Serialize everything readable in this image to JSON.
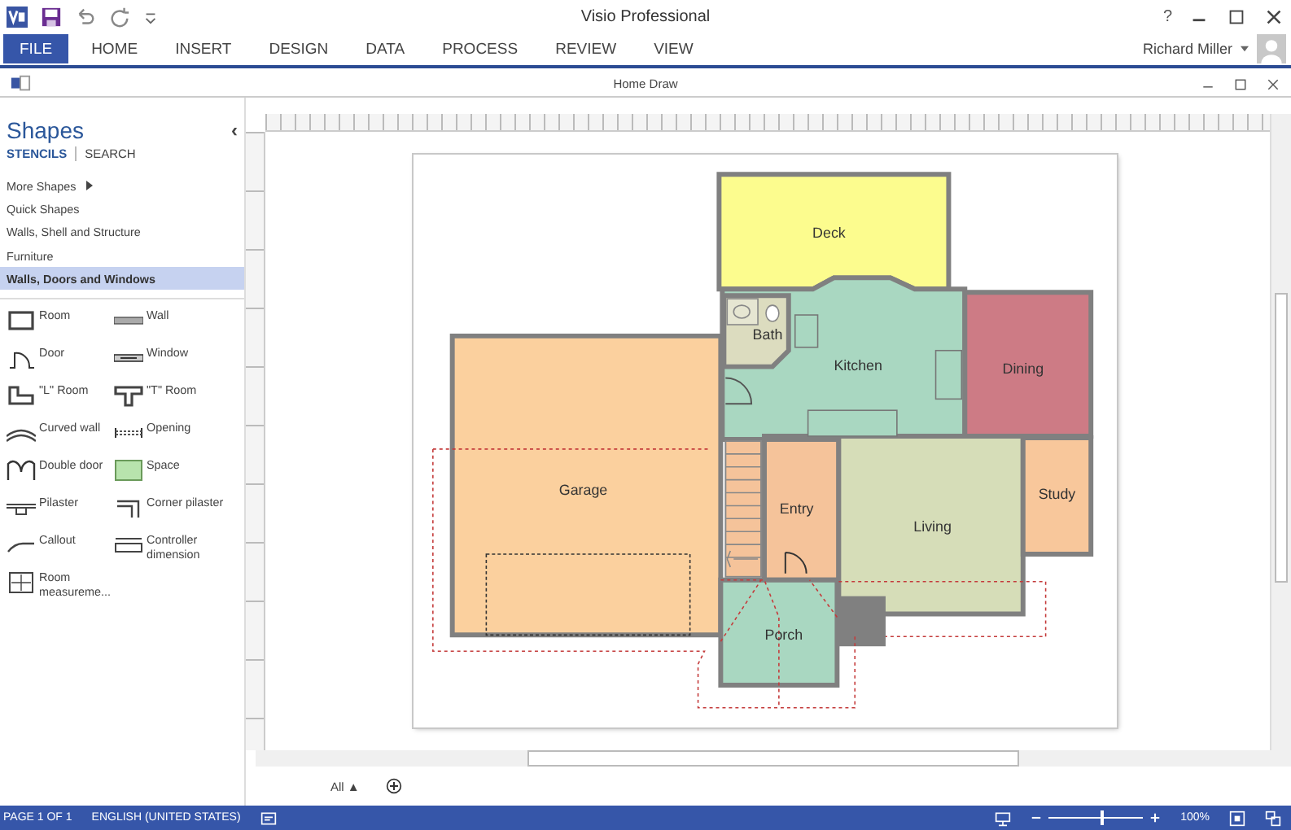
{
  "window": {
    "title": "Visio Professional"
  },
  "ribbon": {
    "tabs": [
      {
        "label": "FILE",
        "selected": true
      },
      {
        "label": "HOME",
        "selected": false
      },
      {
        "label": "INSERT",
        "selected": false
      },
      {
        "label": "DESIGN",
        "selected": false
      },
      {
        "label": "DATA",
        "selected": false
      },
      {
        "label": "PROCESS",
        "selected": false
      },
      {
        "label": "REVIEW",
        "selected": false
      },
      {
        "label": "VIEW",
        "selected": false
      }
    ],
    "user": "Richard Miller",
    "help": "?"
  },
  "document": {
    "title": "Home Draw"
  },
  "shapes_panel": {
    "title": "Shapes",
    "collapse": "‹",
    "tabs": [
      {
        "label": "STENCILS",
        "selected": true
      },
      {
        "label": "SEARCH",
        "selected": false
      }
    ],
    "stencils": [
      {
        "label": "More Shapes",
        "submenu": true,
        "selected": false
      },
      {
        "label": "Quick Shapes",
        "submenu": false,
        "selected": false
      },
      {
        "label": "Walls, Shell and Structure",
        "submenu": false,
        "selected": false
      },
      {
        "label": "Furniture",
        "submenu": false,
        "selected": false
      },
      {
        "label": "Walls, Doors and Windows",
        "submenu": false,
        "selected": true
      }
    ],
    "shapes": [
      {
        "label": "Room",
        "kind": "room"
      },
      {
        "label": "Wall",
        "kind": "wall"
      },
      {
        "label": "Door",
        "kind": "door"
      },
      {
        "label": "Window",
        "kind": "window"
      },
      {
        "label": "\"L\" Room",
        "kind": "lroom"
      },
      {
        "label": "\"T\" Room",
        "kind": "troom"
      },
      {
        "label": "Curved wall",
        "kind": "curved"
      },
      {
        "label": "Opening",
        "kind": "opening"
      },
      {
        "label": "Double door",
        "kind": "doubledoor"
      },
      {
        "label": "Space",
        "kind": "space"
      },
      {
        "label": "Pilaster",
        "kind": "pilaster"
      },
      {
        "label": "Corner pilaster",
        "kind": "corner"
      },
      {
        "label": "Callout",
        "kind": "callout"
      },
      {
        "label": "Controller dimension",
        "kind": "dimension"
      },
      {
        "label": "Room measureme...",
        "kind": "measure"
      }
    ]
  },
  "floor_plan": {
    "rooms": [
      {
        "label": "Deck",
        "color": "#fcfc8e"
      },
      {
        "label": "Kitchen",
        "color": "#a9d7c1"
      },
      {
        "label": "Bath",
        "color": "#dcdcbf"
      },
      {
        "label": "Dining",
        "color": "#cd7b85"
      },
      {
        "label": "Garage",
        "color": "#fbd09e"
      },
      {
        "label": "Entry",
        "color": "#f5c39a"
      },
      {
        "label": "Living",
        "color": "#d6ddb8"
      },
      {
        "label": "Study",
        "color": "#f8c79b"
      },
      {
        "label": "Porch",
        "color": "#a9d7c1"
      }
    ]
  },
  "page_tabs": {
    "tab": "All ▲"
  },
  "status_bar": {
    "page": "PAGE 1 OF 1",
    "language": "ENGLISH (UNITED STATES)",
    "zoom": {
      "level": 0.55,
      "reading": "100%"
    }
  }
}
